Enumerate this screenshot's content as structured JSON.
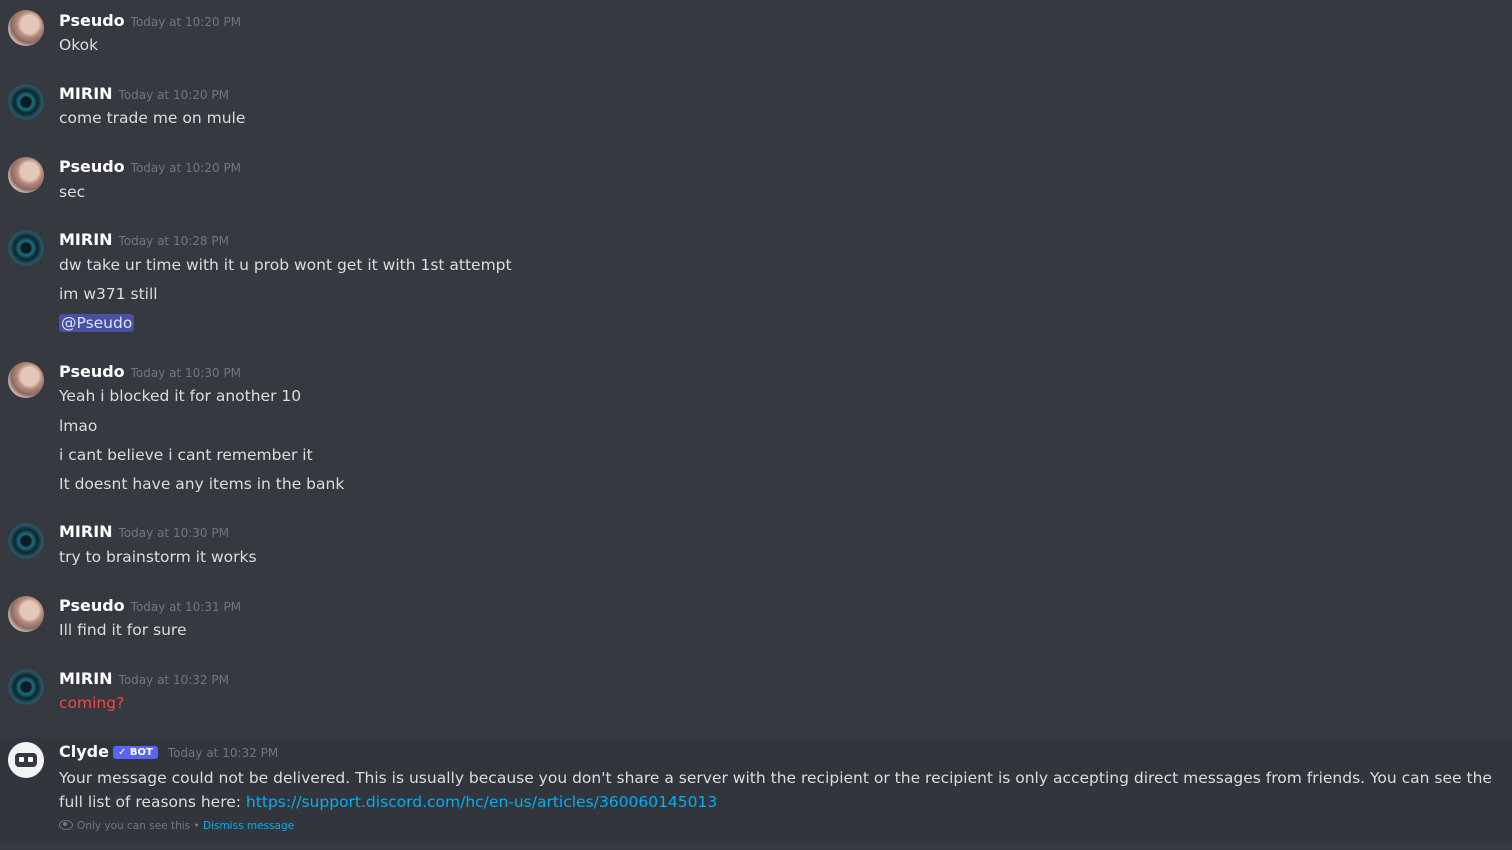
{
  "messages": [
    {
      "author": "Pseudo",
      "time": "Today at 10:20 PM",
      "lines": [
        "Okok"
      ]
    },
    {
      "author": "MIRIN",
      "time": "Today at 10:20 PM",
      "lines": [
        "come trade me on mule"
      ]
    },
    {
      "author": "Pseudo",
      "time": "Today at 10:20 PM",
      "lines": [
        "sec"
      ]
    },
    {
      "author": "MIRIN",
      "time": "Today at 10:28 PM",
      "lines": [
        "dw take ur time with it u prob wont get it with 1st attempt",
        "im w371 still",
        "@Pseudo"
      ]
    },
    {
      "author": "Pseudo",
      "time": "Today at 10:30 PM",
      "lines": [
        "Yeah i blocked it for another 10",
        "lmao",
        "i cant believe i cant remember it",
        "It doesnt have any items in the bank"
      ]
    },
    {
      "author": "MIRIN",
      "time": "Today at 10:30 PM",
      "lines": [
        "try to brainstorm it works"
      ]
    },
    {
      "author": "Pseudo",
      "time": "Today at 10:31 PM",
      "lines": [
        "Ill find it for sure"
      ]
    },
    {
      "author": "MIRIN",
      "time": "Today at 10:32 PM",
      "lines": [
        "coming?"
      ]
    }
  ],
  "clyde": {
    "author": "Clyde",
    "bot_tag": "BOT",
    "time": "Today at 10:32 PM",
    "text": "Your message could not be delivered. This is usually because you don't share a server with the recipient or the recipient is only accepting direct messages from friends. You can see the full list of reasons here: ",
    "link": "https://support.discord.com/hc/en-us/articles/360060145013",
    "ephemeral_note": "Only you can see this",
    "separator": " • ",
    "dismiss": "Dismiss message"
  },
  "colors": {
    "background": "#36393f",
    "failed": "#f04747",
    "link": "#00aff4",
    "bot": "#5865f2"
  }
}
